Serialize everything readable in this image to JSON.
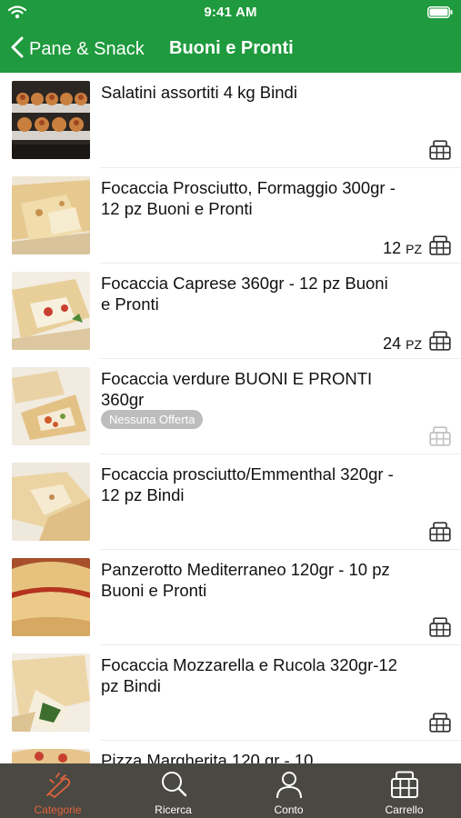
{
  "status_bar": {
    "time": "9:41 AM"
  },
  "nav": {
    "back_label": "Pane & Snack",
    "title": "Buoni e Pronti"
  },
  "products": [
    {
      "name": "Salatini assortiti 4 kg Bindi",
      "quantity": "",
      "unit": "",
      "badge": "",
      "cart_enabled": true
    },
    {
      "name": "Focaccia Prosciutto, Formaggio 300gr - 12 pz Buoni e Pronti",
      "quantity": "12",
      "unit": "PZ",
      "badge": "",
      "cart_enabled": true
    },
    {
      "name": "Focaccia Caprese 360gr - 12 pz Buoni e Pronti",
      "quantity": "24",
      "unit": "PZ",
      "badge": "",
      "cart_enabled": true
    },
    {
      "name": "Focaccia verdure BUONI E PRONTI 360gr",
      "quantity": "",
      "unit": "",
      "badge": "Nessuna Offerta",
      "cart_enabled": false
    },
    {
      "name": "Focaccia prosciutto/Emmenthal 320gr - 12 pz Bindi",
      "quantity": "",
      "unit": "",
      "badge": "",
      "cart_enabled": true
    },
    {
      "name": "Panzerotto Mediterraneo 120gr - 10 pz Buoni e Pronti",
      "quantity": "",
      "unit": "",
      "badge": "",
      "cart_enabled": true
    },
    {
      "name": "Focaccia Mozzarella e Rucola 320gr-12 pz Bindi",
      "quantity": "",
      "unit": "",
      "badge": "",
      "cart_enabled": true
    },
    {
      "name": "Pizza Margherita 120 gr - 10",
      "quantity": "",
      "unit": "",
      "badge": "",
      "cart_enabled": true
    }
  ],
  "tabs": [
    {
      "label": "Categorie",
      "icon": "categories-icon",
      "active": true
    },
    {
      "label": "Ricerca",
      "icon": "search-icon",
      "active": false
    },
    {
      "label": "Conto",
      "icon": "account-icon",
      "active": false
    },
    {
      "label": "Carrello",
      "icon": "cart-icon",
      "active": false
    }
  ],
  "colors": {
    "brand_green": "#1f9a3e",
    "tab_bar": "#4a4843",
    "tab_active": "#e0633a",
    "badge_gray": "#bdbdbd"
  }
}
